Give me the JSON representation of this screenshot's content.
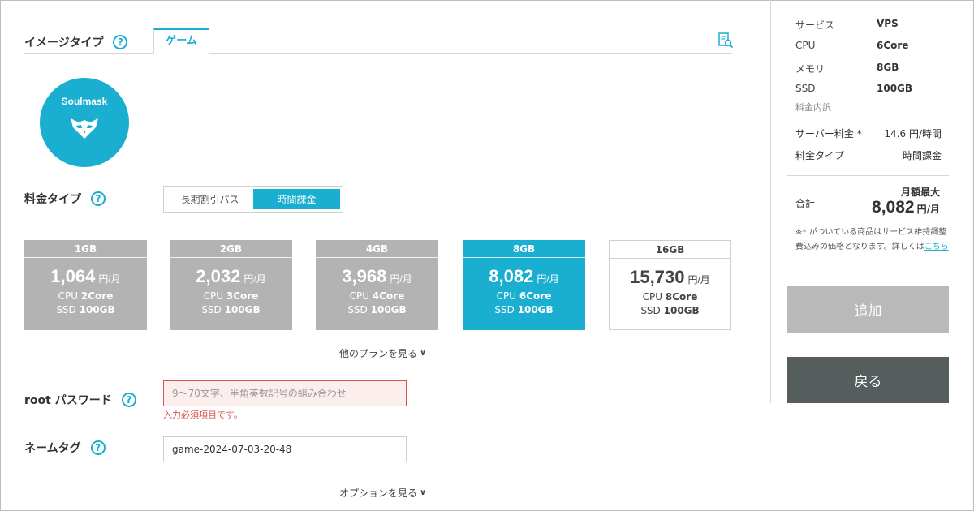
{
  "image_type": {
    "label": "イメージタイプ",
    "help": "?",
    "tab": "ゲーム"
  },
  "game": {
    "name": "Soulmask"
  },
  "pricing": {
    "label": "料金タイプ",
    "help": "?",
    "options": [
      "長期割引パス",
      "時間課金"
    ],
    "selected": "時間課金"
  },
  "plans": [
    {
      "title": "1GB",
      "price": "1,064",
      "unit": "円/月",
      "cpu_prefix": "CPU",
      "cpu": "2Core",
      "ssd_prefix": "SSD",
      "ssd": "100GB"
    },
    {
      "title": "2GB",
      "price": "2,032",
      "unit": "円/月",
      "cpu_prefix": "CPU",
      "cpu": "3Core",
      "ssd_prefix": "SSD",
      "ssd": "100GB"
    },
    {
      "title": "4GB",
      "price": "3,968",
      "unit": "円/月",
      "cpu_prefix": "CPU",
      "cpu": "4Core",
      "ssd_prefix": "SSD",
      "ssd": "100GB"
    },
    {
      "title": "8GB",
      "price": "8,082",
      "unit": "円/月",
      "cpu_prefix": "CPU",
      "cpu": "6Core",
      "ssd_prefix": "SSD",
      "ssd": "100GB"
    },
    {
      "title": "16GB",
      "price": "15,730",
      "unit": "円/月",
      "cpu_prefix": "CPU",
      "cpu": "8Core",
      "ssd_prefix": "SSD",
      "ssd": "100GB"
    }
  ],
  "more_plans": "他のプランを見る",
  "root_password": {
    "label": "root パスワード",
    "help": "?",
    "placeholder": "9～70文字、半角英数記号の組み合わせ",
    "value": "",
    "error": "入力必須項目です。"
  },
  "name_tag": {
    "label": "ネームタグ",
    "help": "?",
    "value": "game-2024-07-03-20-48"
  },
  "options_link": "オプションを見る",
  "summary": {
    "specs": [
      {
        "key": "サービス",
        "value": "VPS"
      },
      {
        "key": "CPU",
        "value": "6Core"
      },
      {
        "key": "メモリ",
        "value": "8GB"
      },
      {
        "key": "SSD",
        "value": "100GB"
      }
    ],
    "breakdown_label": "料金内訳",
    "server_fee_label": "サーバー料金 *",
    "server_fee_value": "14.6 円/時間",
    "fee_type_label": "料金タイプ",
    "fee_type_value": "時間課金",
    "total_label": "合計",
    "total_max_label": "月額最大",
    "total_price": "8,082",
    "total_unit": "円/月",
    "note_text": "※* がついている商品はサービス維持調整費込みの価格となります。詳しくは",
    "note_link": "こちら",
    "add_button": "追加",
    "back_button": "戻る"
  },
  "colors": {
    "accent": "#1aaed1",
    "plan_inactive": "#b3b3b3",
    "error": "#d9534f",
    "back_button": "#555d5d",
    "add_button": "#b9b9b9"
  }
}
